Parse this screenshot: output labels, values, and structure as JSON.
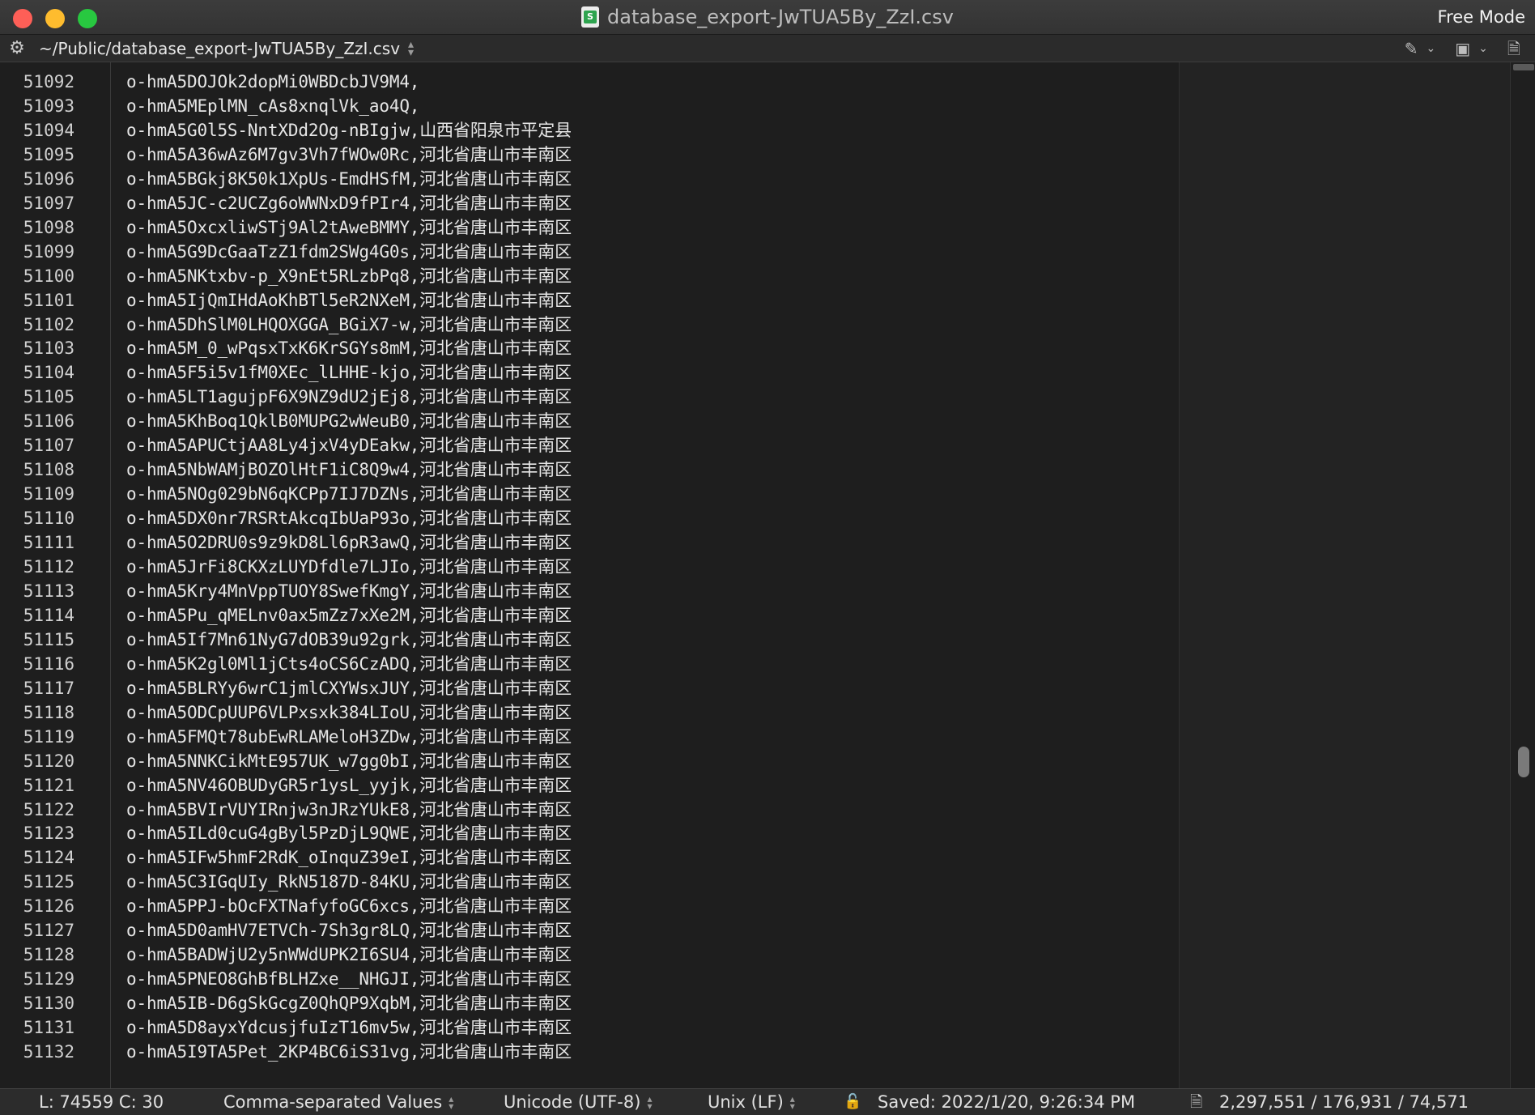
{
  "window": {
    "title": "database_export-JwTUA5By_ZzI.csv",
    "mode": "Free Mode",
    "file_icon": "csv-file-icon"
  },
  "pathbar": {
    "path": "~/Public/database_export-JwTUA5By_ZzI.csv"
  },
  "editor": {
    "lines": [
      {
        "num": "51092",
        "text": "o-hmA5DOJOk2dopMi0WBDcbJV9M4,"
      },
      {
        "num": "51093",
        "text": "o-hmA5MEplMN_cAs8xnqlVk_ao4Q,"
      },
      {
        "num": "51094",
        "text": "o-hmA5G0l5S-NntXDd2Og-nBIgjw,山西省阳泉市平定县"
      },
      {
        "num": "51095",
        "text": "o-hmA5A36wAz6M7gv3Vh7fWOw0Rc,河北省唐山市丰南区"
      },
      {
        "num": "51096",
        "text": "o-hmA5BGkj8K50k1XpUs-EmdHSfM,河北省唐山市丰南区"
      },
      {
        "num": "51097",
        "text": "o-hmA5JC-c2UCZg6oWWNxD9fPIr4,河北省唐山市丰南区"
      },
      {
        "num": "51098",
        "text": "o-hmA5OxcxliwSTj9Al2tAweBMMY,河北省唐山市丰南区"
      },
      {
        "num": "51099",
        "text": "o-hmA5G9DcGaaTzZ1fdm2SWg4G0s,河北省唐山市丰南区"
      },
      {
        "num": "51100",
        "text": "o-hmA5NKtxbv-p_X9nEt5RLzbPq8,河北省唐山市丰南区"
      },
      {
        "num": "51101",
        "text": "o-hmA5IjQmIHdAoKhBTl5eR2NXeM,河北省唐山市丰南区"
      },
      {
        "num": "51102",
        "text": "o-hmA5DhSlM0LHQOXGGA_BGiX7-w,河北省唐山市丰南区"
      },
      {
        "num": "51103",
        "text": "o-hmA5M_0_wPqsxTxK6KrSGYs8mM,河北省唐山市丰南区"
      },
      {
        "num": "51104",
        "text": "o-hmA5F5i5v1fM0XEc_lLHHE-kjo,河北省唐山市丰南区"
      },
      {
        "num": "51105",
        "text": "o-hmA5LT1agujpF6X9NZ9dU2jEj8,河北省唐山市丰南区"
      },
      {
        "num": "51106",
        "text": "o-hmA5KhBoq1QklB0MUPG2wWeuB0,河北省唐山市丰南区"
      },
      {
        "num": "51107",
        "text": "o-hmA5APUCtjAA8Ly4jxV4yDEakw,河北省唐山市丰南区"
      },
      {
        "num": "51108",
        "text": "o-hmA5NbWAMjBOZOlHtF1iC8Q9w4,河北省唐山市丰南区"
      },
      {
        "num": "51109",
        "text": "o-hmA5NOg029bN6qKCPp7IJ7DZNs,河北省唐山市丰南区"
      },
      {
        "num": "51110",
        "text": "o-hmA5DX0nr7RSRtAkcqIbUaP93o,河北省唐山市丰南区"
      },
      {
        "num": "51111",
        "text": "o-hmA5O2DRU0s9z9kD8Ll6pR3awQ,河北省唐山市丰南区"
      },
      {
        "num": "51112",
        "text": "o-hmA5JrFi8CKXzLUYDfdle7LJIo,河北省唐山市丰南区"
      },
      {
        "num": "51113",
        "text": "o-hmA5Kry4MnVppTUOY8SwefKmgY,河北省唐山市丰南区"
      },
      {
        "num": "51114",
        "text": "o-hmA5Pu_qMELnv0ax5mZz7xXe2M,河北省唐山市丰南区"
      },
      {
        "num": "51115",
        "text": "o-hmA5If7Mn61NyG7dOB39u92grk,河北省唐山市丰南区"
      },
      {
        "num": "51116",
        "text": "o-hmA5K2gl0Ml1jCts4oCS6CzADQ,河北省唐山市丰南区"
      },
      {
        "num": "51117",
        "text": "o-hmA5BLRYy6wrC1jmlCXYWsxJUY,河北省唐山市丰南区"
      },
      {
        "num": "51118",
        "text": "o-hmA5ODCpUUP6VLPxsxk384LIoU,河北省唐山市丰南区"
      },
      {
        "num": "51119",
        "text": "o-hmA5FMQt78ubEwRLAMeloH3ZDw,河北省唐山市丰南区"
      },
      {
        "num": "51120",
        "text": "o-hmA5NNKCikMtE957UK_w7gg0bI,河北省唐山市丰南区"
      },
      {
        "num": "51121",
        "text": "o-hmA5NV46OBUDyGR5r1ysL_yyjk,河北省唐山市丰南区"
      },
      {
        "num": "51122",
        "text": "o-hmA5BVIrVUYIRnjw3nJRzYUkE8,河北省唐山市丰南区"
      },
      {
        "num": "51123",
        "text": "o-hmA5ILd0cuG4gByl5PzDjL9QWE,河北省唐山市丰南区"
      },
      {
        "num": "51124",
        "text": "o-hmA5IFw5hmF2RdK_oInquZ39eI,河北省唐山市丰南区"
      },
      {
        "num": "51125",
        "text": "o-hmA5C3IGqUIy_RkN5187D-84KU,河北省唐山市丰南区"
      },
      {
        "num": "51126",
        "text": "o-hmA5PPJ-bOcFXTNafyfoGC6xcs,河北省唐山市丰南区"
      },
      {
        "num": "51127",
        "text": "o-hmA5D0amHV7ETVCh-7Sh3gr8LQ,河北省唐山市丰南区"
      },
      {
        "num": "51128",
        "text": "o-hmA5BADWjU2y5nWWdUPK2I6SU4,河北省唐山市丰南区"
      },
      {
        "num": "51129",
        "text": "o-hmA5PNEO8GhBfBLHZxe__NHGJI,河北省唐山市丰南区"
      },
      {
        "num": "51130",
        "text": "o-hmA5IB-D6gSkGcgZ0QhQP9XqbM,河北省唐山市丰南区"
      },
      {
        "num": "51131",
        "text": "o-hmA5D8ayxYdcusjfuIzT16mv5w,河北省唐山市丰南区"
      },
      {
        "num": "51132",
        "text": "o-hmA5I9TA5Pet_2KP4BC6iS31vg,河北省唐山市丰南区"
      }
    ]
  },
  "statusbar": {
    "position": "L: 74559 C: 30",
    "syntax": "Comma-separated Values",
    "encoding": "Unicode (UTF-8)",
    "line_endings": "Unix (LF)",
    "saved": "Saved: 2022/1/20, 9:26:34 PM",
    "counts": "2,297,551 / 176,931 / 74,571"
  },
  "colors": {
    "close": "#fe5f57",
    "minimize": "#febc2e",
    "zoom": "#28c840",
    "csv_badge": "#2ea44f"
  }
}
